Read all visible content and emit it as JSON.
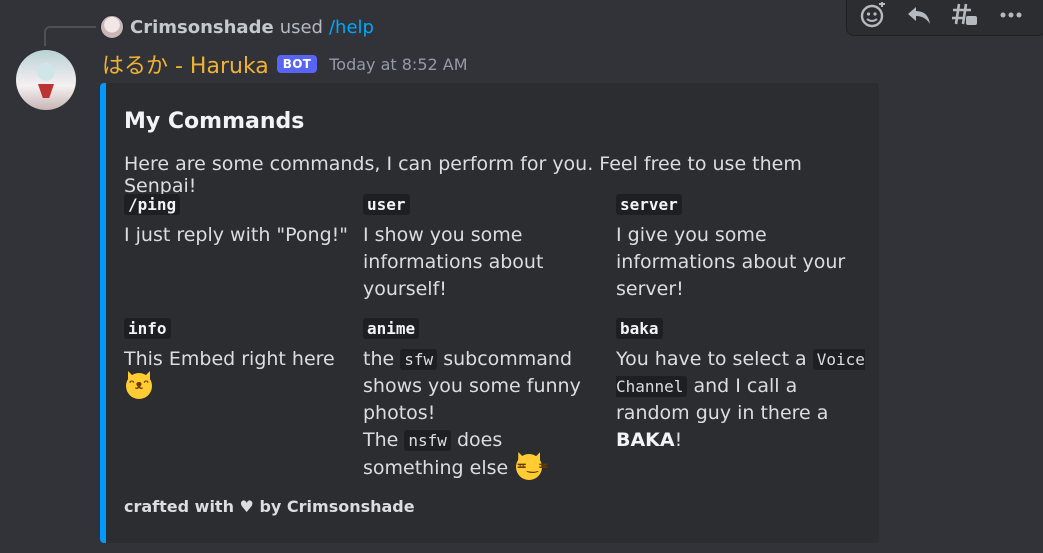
{
  "reply": {
    "user": "Crimsonshade",
    "used": "used",
    "command": "/help"
  },
  "toolbar": {
    "icons": [
      "add-reaction-icon",
      "reply-icon",
      "create-thread-icon",
      "more-icon"
    ]
  },
  "message": {
    "username": "はるか - Haruka",
    "badge": "BOT",
    "timestamp": "Today at 8:52 AM"
  },
  "embed": {
    "accent_color": "#0099ff",
    "title": "My Commands",
    "description": "Here are some commands, I can perform for you. Feel free to use them Senpai!",
    "fields": [
      {
        "name": "/ping",
        "value": "I just reply with \"Pong!\""
      },
      {
        "name": "user",
        "value": "I show you some informations about yourself!"
      },
      {
        "name": "server",
        "value": "I give you some informations about your server!"
      },
      {
        "name": "info",
        "value": "This Embed right here",
        "emoji": "smiling-cat-emoji"
      },
      {
        "name": "anime",
        "parts": {
          "a1": "the",
          "a2": "sfw",
          "a3": "subcommand shows you some funny photos!",
          "a4": "The",
          "a5": "nsfw",
          "a6": "does something else"
        },
        "emoji": "smirking-cat-emoji"
      },
      {
        "name": "baka",
        "parts": {
          "b1": "You have to select a",
          "b2": "Voice Channel",
          "b3": "and I call a random guy in there a",
          "b4": "BAKA",
          "b5": "!"
        }
      }
    ],
    "footer": "crafted with ♥ by Crimsonshade"
  }
}
